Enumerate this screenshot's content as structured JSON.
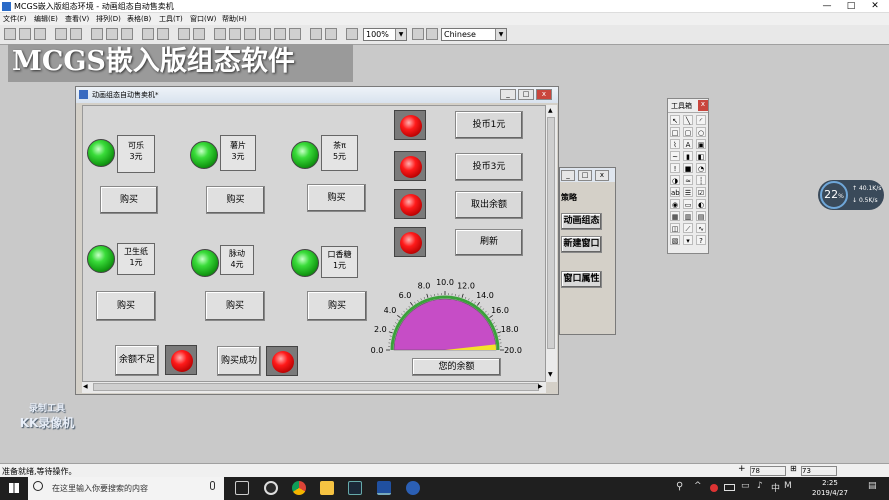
{
  "app": {
    "title": "MCGS嵌入版组态环境 - 动画组态自动售卖机"
  },
  "menu": [
    "文件(F)",
    "编辑(E)",
    "查看(V)",
    "排列(D)",
    "表格(B)",
    "工具(T)",
    "窗口(W)",
    "帮助(H)"
  ],
  "toolbar": {
    "zoom": "100%",
    "language": "Chinese"
  },
  "banner": "MCGS嵌入版组态软件",
  "window": {
    "title": "动画组态自动售卖机*"
  },
  "products": [
    {
      "name": "可乐",
      "price": "3元",
      "buy": "购买"
    },
    {
      "name": "薯片",
      "price": "3元",
      "buy": "购买"
    },
    {
      "name": "茶π",
      "price": "5元",
      "buy": "购买"
    },
    {
      "name": "卫生纸",
      "price": "1元",
      "buy": "购买"
    },
    {
      "name": "脉动",
      "price": "4元",
      "buy": "购买"
    },
    {
      "name": "口香糖",
      "price": "1元",
      "buy": "购买"
    }
  ],
  "coins": {
    "one": "投币1元",
    "three": "投币3元",
    "refund": "取出余额",
    "refresh": "刷新"
  },
  "status_labels": {
    "insufficient": "余额不足",
    "success": "购买成功"
  },
  "gauge": {
    "ticks": [
      "0.0",
      "2.0",
      "4.0",
      "6.0",
      "8.0",
      "10.0",
      "12.0",
      "14.0",
      "16.0",
      "18.0",
      "20.0"
    ],
    "label": "您的余额",
    "min": 0,
    "max": 20,
    "value": 0.7
  },
  "side_window": {
    "tab": "策略",
    "buttons": [
      "动画组态",
      "新建窗口",
      "窗口属性"
    ]
  },
  "toolbox": {
    "title": "工具箱"
  },
  "netmon": {
    "percent": "22",
    "up": "40.1",
    "up_unit": "K/s",
    "down": "0.5",
    "down_unit": "K/s"
  },
  "statusbar": {
    "text": "准备就绪,等待操作。",
    "x": "78",
    "y": "73"
  },
  "taskbar": {
    "search_placeholder": "在这里输入你要搜索的内容",
    "time": "2:25",
    "date": "2019/4/27",
    "ime": "中"
  },
  "watermark": {
    "line1": "录制工具",
    "line2": "KK录像机"
  }
}
